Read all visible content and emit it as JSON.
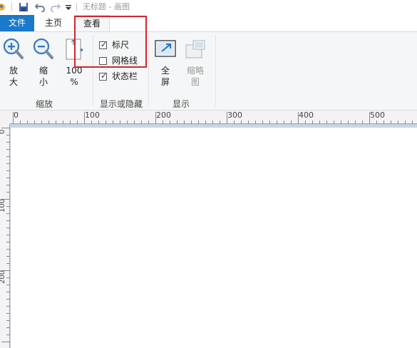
{
  "window": {
    "title": "无标题 - 画图",
    "quick_access": [
      "save-icon",
      "undo-icon",
      "redo-icon",
      "customize-dropdown-icon"
    ]
  },
  "tabs": {
    "file": "文件",
    "home": "主页",
    "view": "查看"
  },
  "ribbon": {
    "zoom_group": {
      "label": "缩放",
      "zoom_in": {
        "line1": "放",
        "line2": "大"
      },
      "zoom_out": {
        "line1": "缩",
        "line2": "小"
      },
      "zoom_100": {
        "line1": "100",
        "line2": "%"
      }
    },
    "show_hide_group": {
      "label": "显示或隐藏",
      "ruler": {
        "label": "标尺",
        "checked": true
      },
      "gridlines": {
        "label": "网格线",
        "checked": false
      },
      "statusbar": {
        "label": "状态栏",
        "checked": true
      }
    },
    "display_group": {
      "label": "显示",
      "fullscreen": {
        "line1": "全",
        "line2": "屏"
      },
      "thumbnail": {
        "line1": "缩略",
        "line2": "图"
      }
    }
  },
  "rulers": {
    "horizontal": [
      "0",
      "100",
      "200",
      "300",
      "400",
      "500"
    ],
    "vertical": [
      "0",
      "100",
      "200"
    ]
  },
  "colors": {
    "file_tab": "#1979ca",
    "highlight_box": "#d0262d",
    "canvas_background": "#c9d4e4"
  }
}
